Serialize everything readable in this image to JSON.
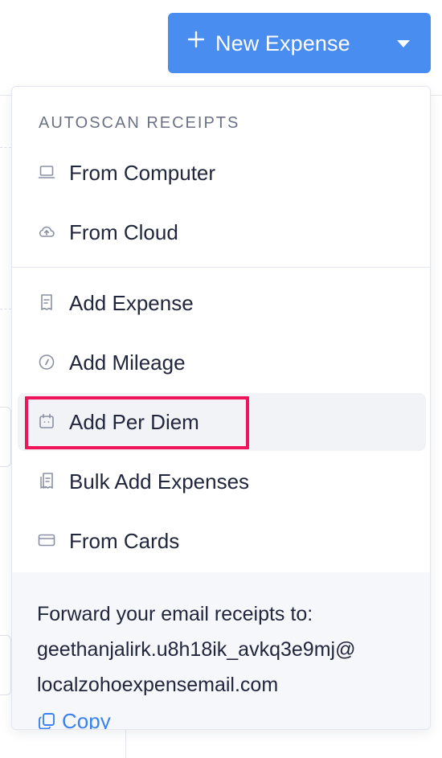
{
  "button": {
    "label": "New Expense"
  },
  "menu": {
    "section_title": "AUTOSCAN RECEIPTS",
    "autoscan_items": [
      {
        "label": "From Computer",
        "icon": "laptop-icon"
      },
      {
        "label": "From Cloud",
        "icon": "cloud-upload-icon"
      }
    ],
    "add_items": [
      {
        "label": "Add Expense",
        "icon": "receipt-icon"
      },
      {
        "label": "Add Mileage",
        "icon": "speedometer-icon"
      },
      {
        "label": "Add Per Diem",
        "icon": "calendar-icon",
        "highlighted": true
      },
      {
        "label": "Bulk Add Expenses",
        "icon": "stacked-receipts-icon"
      },
      {
        "label": "From Cards",
        "icon": "credit-card-icon"
      }
    ]
  },
  "footer": {
    "forward_text": "Forward your email receipts to:",
    "email_line1": "geethanjalirk.u8h18ik_avkq3e9mj@",
    "email_line2": "localzohoexpensemail.com",
    "copy_label": "Copy"
  },
  "colors": {
    "primary": "#4a8df1",
    "highlight_box": "#f0145a",
    "link": "#3a82ef",
    "hover_bg": "#f2f3f7"
  }
}
